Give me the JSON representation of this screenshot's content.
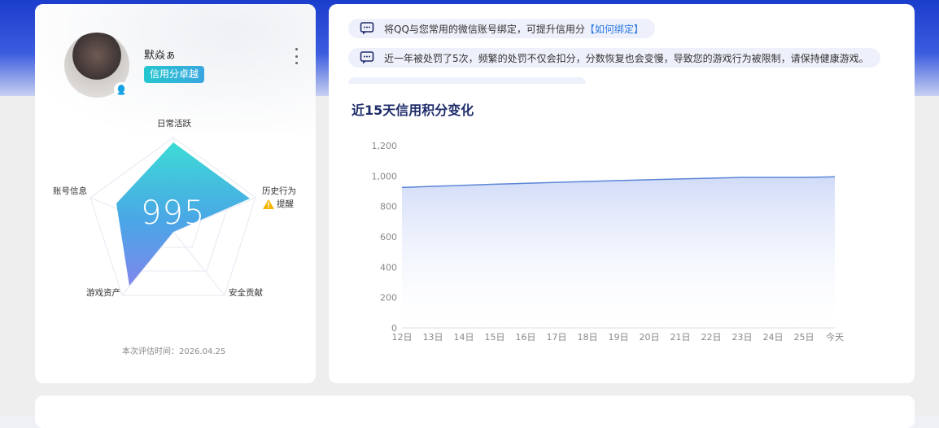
{
  "profile": {
    "username": "默焱ぁ",
    "credit_level": "信用分卓越"
  },
  "radar": {
    "score": "995",
    "labels": {
      "top": "日常活跃",
      "right": "历史行为",
      "bottom_right": "安全贡献",
      "bottom_left": "游戏资产",
      "left": "账号信息"
    },
    "warning": "提醒",
    "eval_time": "本次评估时间：2026.04.25"
  },
  "notices": [
    {
      "text": "将QQ与您常用的微信账号绑定，可提升信用分",
      "link": "【如何绑定】"
    },
    {
      "text": "近一年被处罚了5次，频繁的处罚不仅会扣分，分数恢复也会变慢，导致您的游戏行为被限制，请保持健康游戏。",
      "link": ""
    }
  ],
  "chart_title": "近15天信用积分变化",
  "colors": {
    "accent": "#2b78e4",
    "line": "#5b86d6",
    "badge": "#25c6cf"
  },
  "chart_data": {
    "type": "area",
    "categories": [
      "12日",
      "13日",
      "14日",
      "15日",
      "16日",
      "17日",
      "18日",
      "19日",
      "20日",
      "21日",
      "22日",
      "23日",
      "24日",
      "25日",
      "今天"
    ],
    "values": [
      925,
      932,
      939,
      946,
      952,
      958,
      964,
      970,
      976,
      981,
      986,
      991,
      991,
      991,
      995
    ],
    "yticks": [
      "1,200",
      "1,000",
      "800",
      "600",
      "400",
      "200",
      "0"
    ],
    "ylim": [
      0,
      1200
    ],
    "grid": false
  }
}
